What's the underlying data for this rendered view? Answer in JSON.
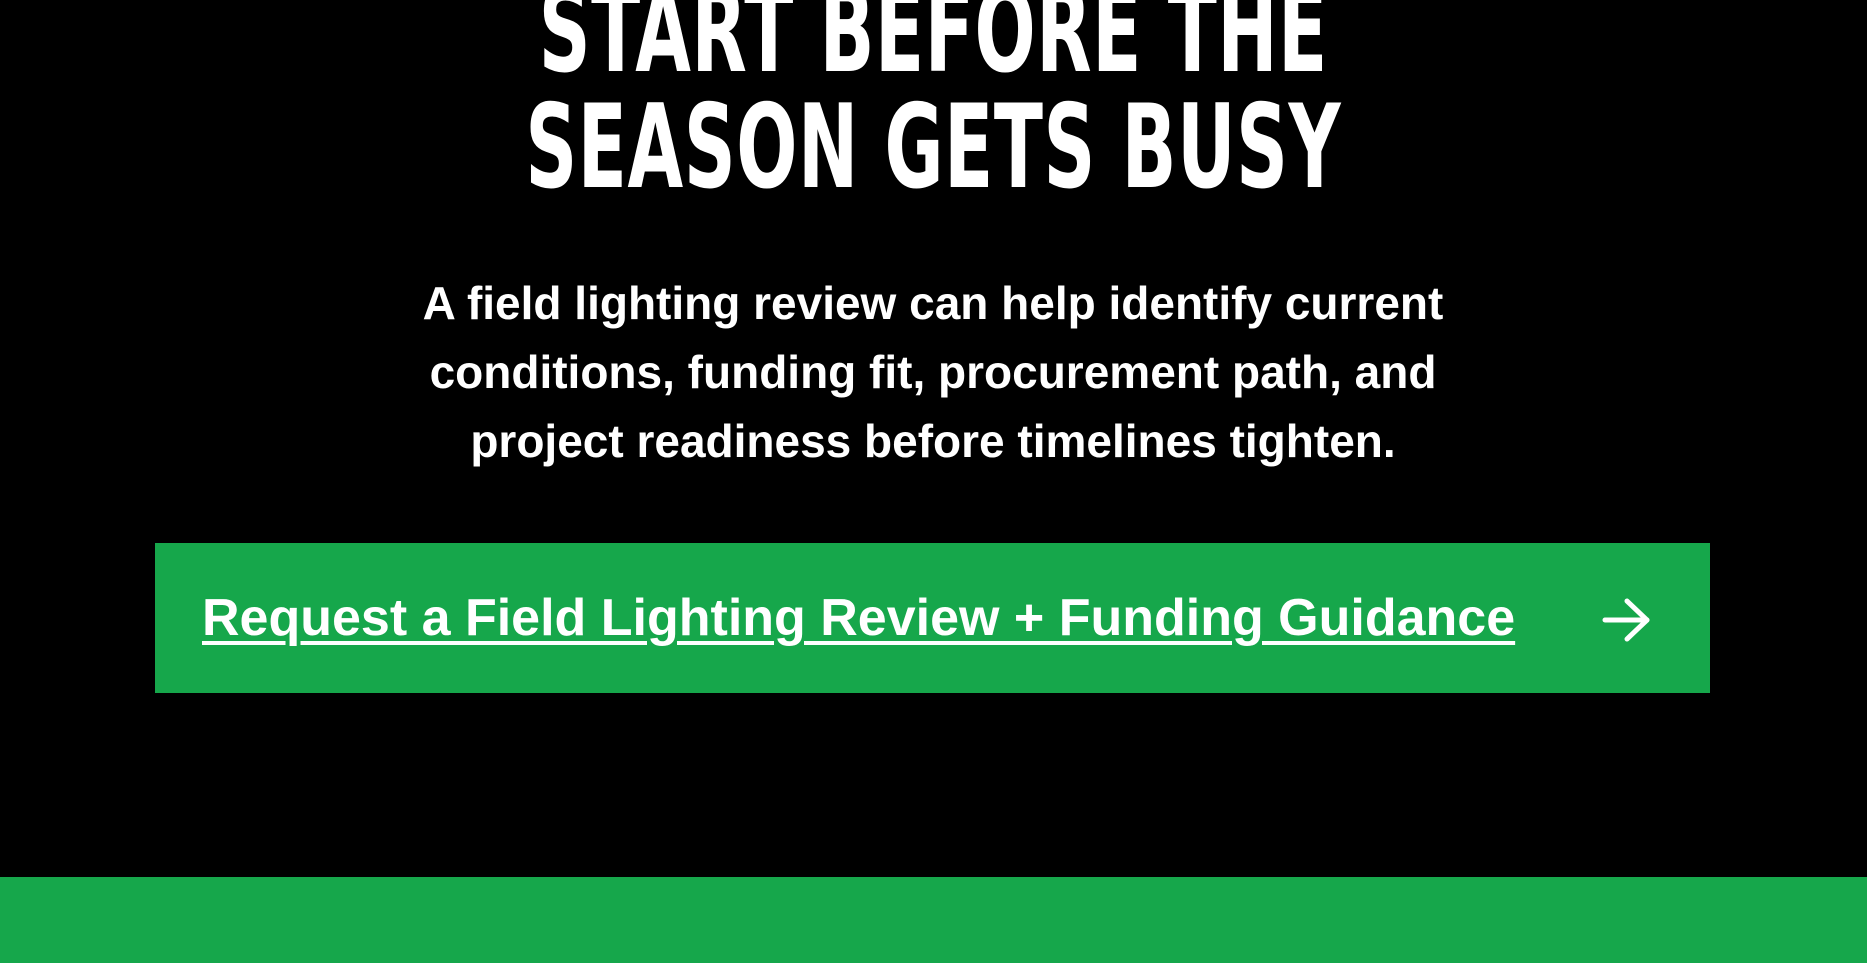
{
  "colors": {
    "background": "#000000",
    "accent_green": "#16a74b",
    "text": "#ffffff"
  },
  "hero": {
    "headline_line1": "START BEFORE THE",
    "headline_line2": "SEASON GETS BUSY",
    "subtext": "A field lighting review can help identify current conditions, funding fit, procurement path, and project readiness before timelines tighten."
  },
  "cta": {
    "label": "Request a Field Lighting Review + Funding Guidance",
    "icon": "arrow-right-icon"
  }
}
